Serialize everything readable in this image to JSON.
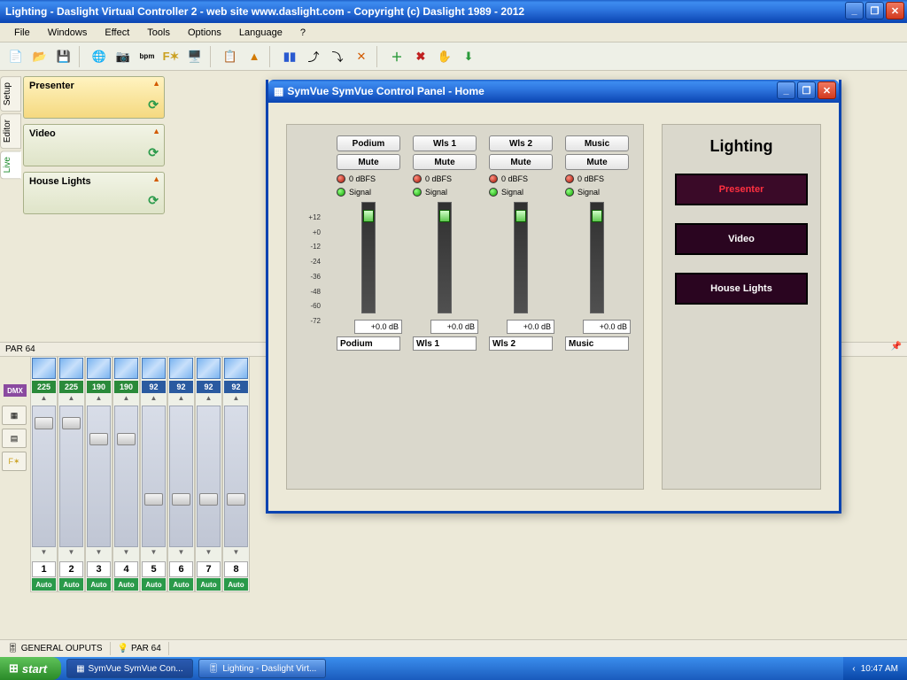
{
  "main_window": {
    "title": "Lighting - Daslight Virtual Controller 2  -  web site www.daslight.com  -  Copyright (c) Daslight 1989 - 2012"
  },
  "menu": {
    "file": "File",
    "windows": "Windows",
    "effect": "Effect",
    "tools": "Tools",
    "options": "Options",
    "language": "Language",
    "help": "?"
  },
  "vtabs": {
    "setup": "Setup",
    "editor": "Editor",
    "live": "Live"
  },
  "scenes": [
    {
      "label": "Presenter",
      "active": true
    },
    {
      "label": "Video",
      "active": false
    },
    {
      "label": "House Lights",
      "active": false
    }
  ],
  "par64": {
    "label": "PAR 64",
    "dmx_label": "DMX",
    "channels": [
      {
        "num": "1",
        "val": "225",
        "pos": 12,
        "color": "g"
      },
      {
        "num": "2",
        "val": "225",
        "pos": 12,
        "color": "g"
      },
      {
        "num": "3",
        "val": "190",
        "pos": 30,
        "color": "g"
      },
      {
        "num": "4",
        "val": "190",
        "pos": 30,
        "color": "g"
      },
      {
        "num": "5",
        "val": "92",
        "pos": 98,
        "color": "b"
      },
      {
        "num": "6",
        "val": "92",
        "pos": 98,
        "color": "b"
      },
      {
        "num": "7",
        "val": "92",
        "pos": 98,
        "color": "b"
      },
      {
        "num": "8",
        "val": "92",
        "pos": 98,
        "color": "b"
      }
    ],
    "auto": "Auto"
  },
  "bottom_tabs": {
    "general": "GENERAL OUPUTS",
    "par64": "PAR 64"
  },
  "symvue": {
    "title": "SymVue SymVue Control Panel - Home",
    "scale": [
      "+12",
      "+0",
      "-12",
      "-24",
      "-36",
      "-48",
      "-60",
      "-72"
    ],
    "mute": "Mute",
    "dbfs": "0 dBFS",
    "signal": "Signal",
    "channels": [
      {
        "label": "Podium",
        "db": "+0.0 dB"
      },
      {
        "label": "Wls 1",
        "db": "+0.0 dB"
      },
      {
        "label": "Wls 2",
        "db": "+0.0 dB"
      },
      {
        "label": "Music",
        "db": "+0.0 dB"
      }
    ],
    "lighting": {
      "title": "Lighting",
      "presenter": "Presenter",
      "video": "Video",
      "house": "House Lights"
    }
  },
  "taskbar": {
    "start": "start",
    "task1": "SymVue SymVue Con...",
    "task2": "Lighting - Daslight Virt...",
    "time": "10:47 AM"
  }
}
